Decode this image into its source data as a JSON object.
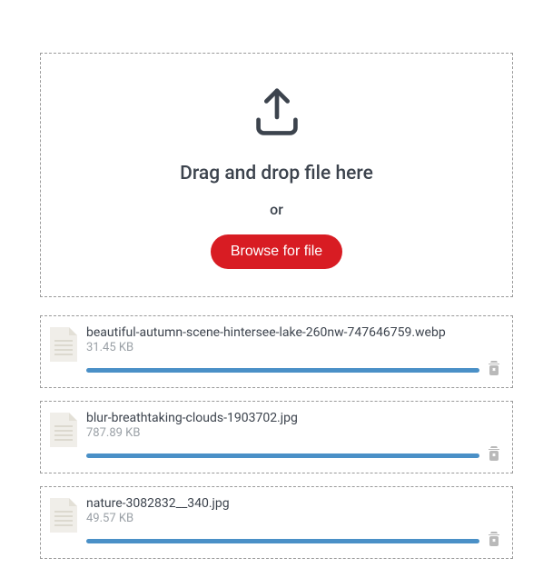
{
  "dropzone": {
    "title": "Drag and drop file here",
    "or": "or",
    "browse_label": "Browse for file"
  },
  "files": [
    {
      "name": "beautiful-autumn-scene-hintersee-lake-260nw-747646759.webp",
      "size": "31.45 KB",
      "progress": 100
    },
    {
      "name": "blur-breathtaking-clouds-1903702.jpg",
      "size": "787.89 KB",
      "progress": 100
    },
    {
      "name": "nature-3082832__340.jpg",
      "size": "49.57 KB",
      "progress": 100
    }
  ],
  "colors": {
    "accent": "#d81c23",
    "progress": "#4a90c7"
  }
}
